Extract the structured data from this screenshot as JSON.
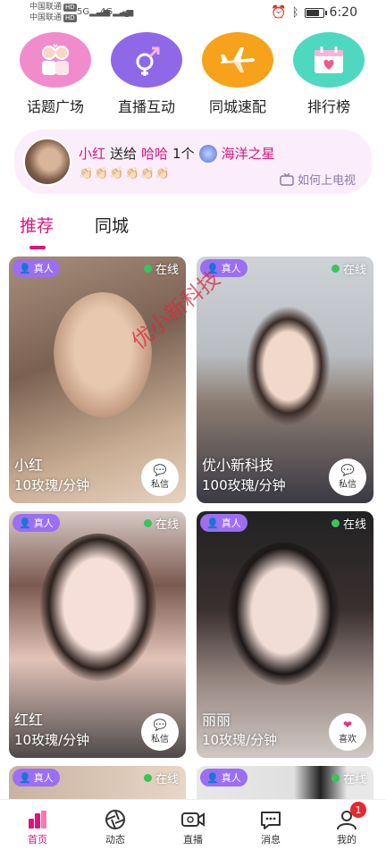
{
  "status_bar": {
    "carrier_1": "中国联通",
    "carrier_2": "中国联通",
    "hd_tag": "HD",
    "net_1": "5G",
    "net_2": "4G",
    "time": "6:20"
  },
  "categories": [
    {
      "label": "话题广场",
      "icon": "couple-icon",
      "color": "#f08ccc"
    },
    {
      "label": "直播互动",
      "icon": "gender-icon",
      "color": "#8f68e8"
    },
    {
      "label": "同城速配",
      "icon": "airplane-icon",
      "color": "#f7a21b"
    },
    {
      "label": "排行榜",
      "icon": "calendar-heart-icon",
      "color": "#4ed8c0"
    }
  ],
  "banner": {
    "sender": "小红",
    "action": "送给",
    "receiver": "哈哈",
    "count": "1个",
    "gift": "海洋之星",
    "claps": "👏🏻👏🏻👏🏻👏🏻👏🏻👏🏻",
    "tv_link": "如何上电视"
  },
  "tabs": [
    {
      "label": "推荐",
      "active": true
    },
    {
      "label": "同城",
      "active": false
    }
  ],
  "cards": [
    {
      "name": "小红",
      "price": "10玫瑰/分钟",
      "real_badge": "真人",
      "status": "在线",
      "action": "私信"
    },
    {
      "name": "优小新科技",
      "price": "100玫瑰/分钟",
      "real_badge": "真人",
      "status": "在线",
      "action": "私信"
    },
    {
      "name": "红红",
      "price": "10玫瑰/分钟",
      "real_badge": "真人",
      "status": "在线",
      "action": "私信"
    },
    {
      "name": "丽丽",
      "price": "10玫瑰/分钟",
      "real_badge": "真人",
      "status": "在线",
      "action": "喜欢"
    },
    {
      "real_badge": "真人",
      "status": "在线"
    },
    {
      "real_badge": "真人",
      "status": "在线"
    }
  ],
  "watermark": "优小新科技",
  "bottom_nav": [
    {
      "label": "首页",
      "icon": "home-icon",
      "active": true
    },
    {
      "label": "动态",
      "icon": "aperture-icon",
      "active": false
    },
    {
      "label": "直播",
      "icon": "video-camera-icon",
      "active": false
    },
    {
      "label": "消息",
      "icon": "chat-icon",
      "active": false
    },
    {
      "label": "我的",
      "icon": "person-icon",
      "active": false,
      "badge": "1"
    }
  ],
  "colors": {
    "accent": "#e0127c",
    "badge_purple": "#9b6ef2",
    "online_green": "#35c759",
    "banner_bg": "#fbeefa",
    "notification_red": "#e8262e"
  }
}
